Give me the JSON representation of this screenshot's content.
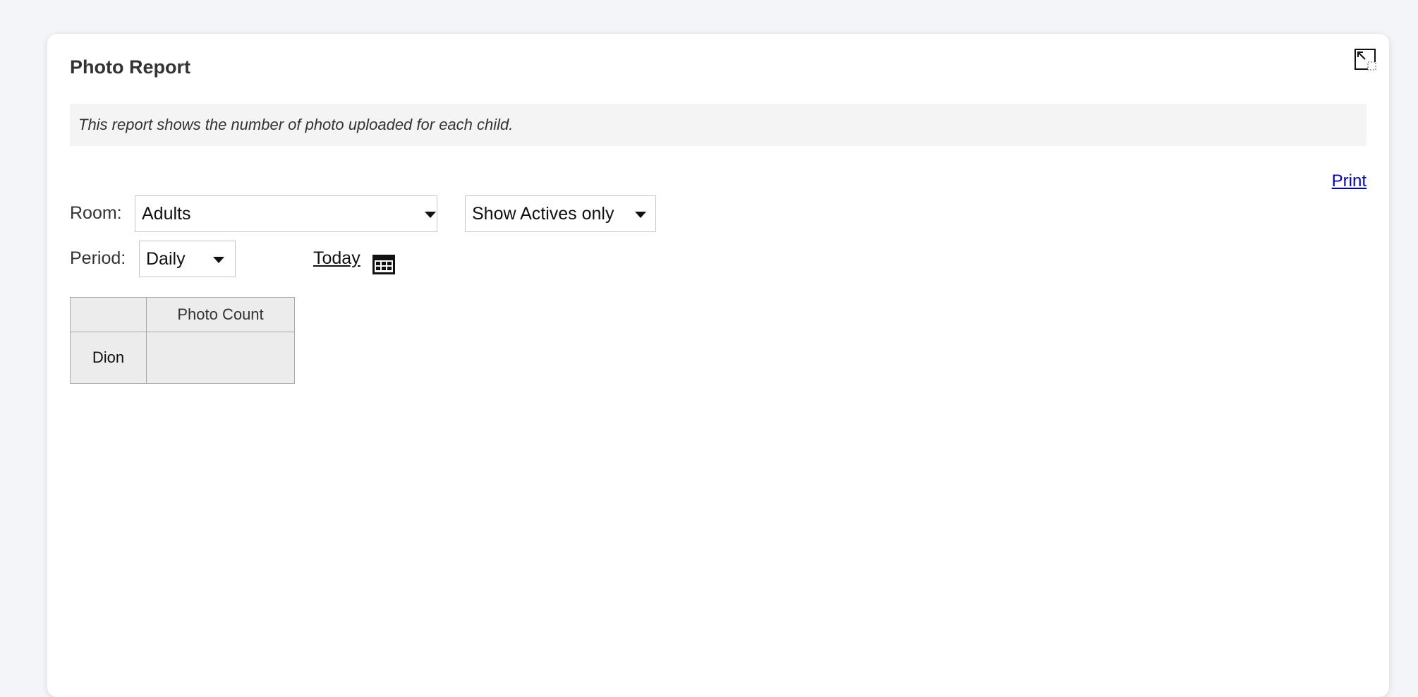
{
  "report": {
    "title": "Photo Report",
    "description": "This report shows the number of photo uploaded for each child.",
    "print_label": "Print"
  },
  "filters": {
    "room_label": "Room:",
    "room_value": "Adults",
    "status_value": "Show Actives only",
    "period_label": "Period:",
    "period_value": "Daily",
    "today_label": "Today"
  },
  "table": {
    "columns": [
      "",
      "Photo Count"
    ],
    "rows": [
      {
        "name": "Dion",
        "photo_count": ""
      }
    ]
  },
  "icons": {
    "expand": "expand-icon",
    "calendar": "calendar-icon"
  }
}
